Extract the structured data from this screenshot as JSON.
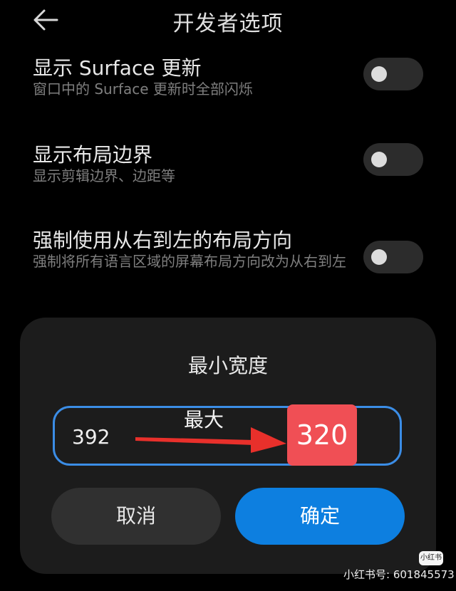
{
  "header": {
    "back_icon": "arrow-left-icon",
    "title": "开发者选项"
  },
  "settings": [
    {
      "title": "显示 Surface 更新",
      "description": "窗口中的 Surface 更新时全部闪烁",
      "enabled": false
    },
    {
      "title": "显示布局边界",
      "description": "显示剪辑边界、边距等",
      "enabled": false
    },
    {
      "title": "强制使用从右到左的布局方向",
      "description": "强制将所有语言区域的屏幕布局方向改为从右到左",
      "enabled": false
    }
  ],
  "dialog": {
    "title": "最小宽度",
    "input_value": "392",
    "annotation_label": "最大",
    "annotation_value": "320",
    "cancel_label": "取消",
    "confirm_label": "确定"
  },
  "watermark": {
    "logo_text": "小红书",
    "text": "小红书号: 601845573"
  },
  "colors": {
    "background": "#000000",
    "dialog_background": "#1c1c1c",
    "accent_blue": "#0d7fe0",
    "annotation_red": "#f04f55",
    "arrow_red": "#e8302b"
  }
}
